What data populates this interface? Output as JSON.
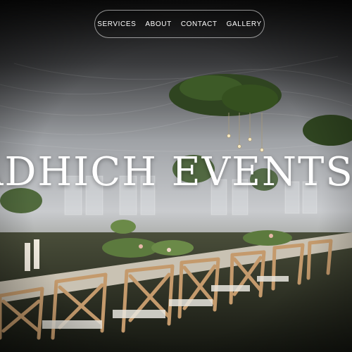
{
  "nav": {
    "items": [
      {
        "label": "SERVICES"
      },
      {
        "label": "ABOUT"
      },
      {
        "label": "CONTACT"
      },
      {
        "label": "GALLERY"
      }
    ]
  },
  "hero": {
    "title": "ADHICH EVENTS"
  },
  "colors": {
    "nav_border": "#ffffff",
    "text": "#ffffff",
    "tent_fabric": "#cfd0d2",
    "chairs": "#c49a6c",
    "greenery": "#3f5a2c"
  },
  "icons": [
    "hanging-greenery",
    "chandelier-bulbs"
  ]
}
